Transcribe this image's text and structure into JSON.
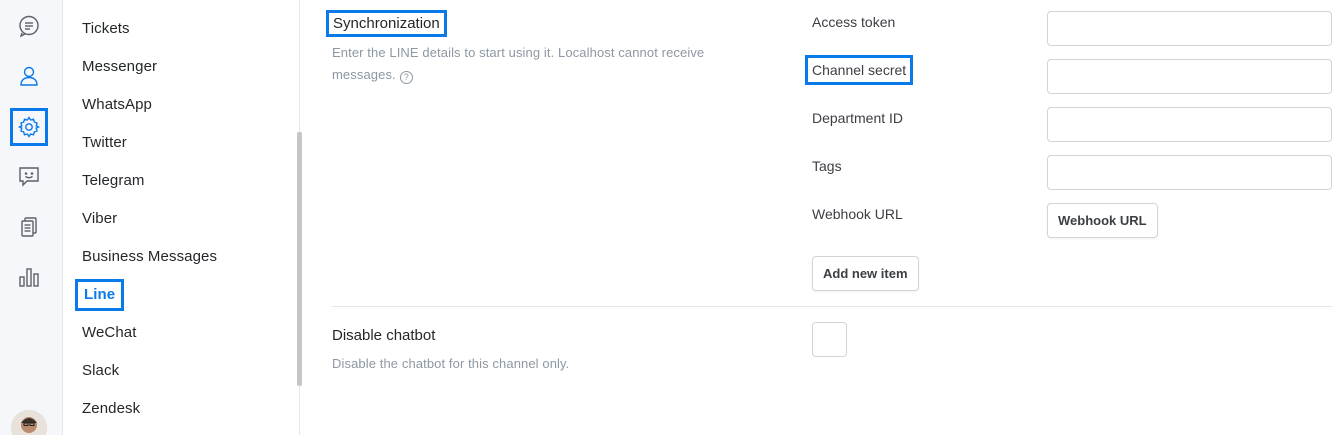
{
  "rail": {
    "icons": [
      "chat-bubble-icon",
      "user-icon",
      "gear-icon",
      "chatbot-icon",
      "documents-icon",
      "bar-chart-icon"
    ],
    "accent": "#0a7aeb"
  },
  "channels": {
    "items": [
      "Tickets",
      "Messenger",
      "WhatsApp",
      "Twitter",
      "Telegram",
      "Viber",
      "Business Messages",
      "Line",
      "WeChat",
      "Slack",
      "Zendesk"
    ],
    "active": "Line"
  },
  "sync": {
    "title": "Synchronization",
    "description": "Enter the LINE details to start using it. Localhost cannot receive messages.",
    "help_glyph": "?"
  },
  "fields": {
    "access_token": {
      "label": "Access token",
      "value": ""
    },
    "channel_secret": {
      "label": "Channel secret",
      "value": ""
    },
    "department_id": {
      "label": "Department ID",
      "value": ""
    },
    "tags": {
      "label": "Tags",
      "value": ""
    },
    "webhook_url": {
      "label": "Webhook URL",
      "button": "Webhook URL"
    }
  },
  "add_new_item": "Add new item",
  "chatbot": {
    "title": "Disable chatbot",
    "description": "Disable the chatbot for this channel only.",
    "checked": false
  }
}
